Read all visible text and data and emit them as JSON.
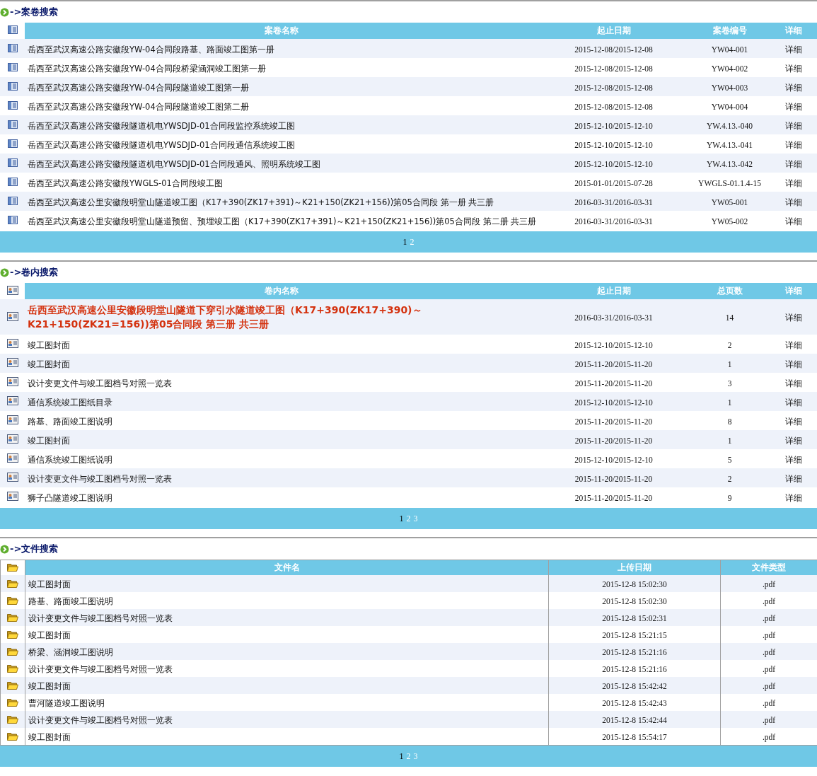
{
  "sections": [
    {
      "kind": "volume",
      "title": "->案卷搜索",
      "columns": [
        "案卷名称",
        "起止日期",
        "案卷编号",
        "详细"
      ],
      "rows": [
        {
          "selected": false,
          "cells": [
            "岳西至武汉高速公路安徽段YW-04合同段路基、路面竣工图第一册",
            "2015-12-08/2015-12-08",
            "YW04-001",
            "详细"
          ]
        },
        {
          "selected": false,
          "cells": [
            "岳西至武汉高速公路安徽段YW-04合同段桥梁涵洞竣工图第一册",
            "2015-12-08/2015-12-08",
            "YW04-002",
            "详细"
          ]
        },
        {
          "selected": false,
          "cells": [
            "岳西至武汉高速公路安徽段YW-04合同段隧道竣工图第一册",
            "2015-12-08/2015-12-08",
            "YW04-003",
            "详细"
          ]
        },
        {
          "selected": false,
          "cells": [
            "岳西至武汉高速公路安徽段YW-04合同段隧道竣工图第二册",
            "2015-12-08/2015-12-08",
            "YW04-004",
            "详细"
          ]
        },
        {
          "selected": false,
          "cells": [
            "岳西至武汉高速公路安徽段隧道机电YWSDJD-01合同段监控系统竣工图",
            "2015-12-10/2015-12-10",
            "YW.4.13.-040",
            "详细"
          ]
        },
        {
          "selected": false,
          "cells": [
            "岳西至武汉高速公路安徽段隧道机电YWSDJD-01合同段通信系统竣工图",
            "2015-12-10/2015-12-10",
            "YW.4.13.-041",
            "详细"
          ]
        },
        {
          "selected": false,
          "cells": [
            "岳西至武汉高速公路安徽段隧道机电YWSDJD-01合同段通风、照明系统竣工图",
            "2015-12-10/2015-12-10",
            "YW.4.13.-042",
            "详细"
          ]
        },
        {
          "selected": false,
          "cells": [
            "岳西至武汉高速公路安徽段YWGLS-01合同段竣工图",
            "2015-01-01/2015-07-28",
            "YWGLS-01.1.4-15",
            "详细"
          ]
        },
        {
          "selected": false,
          "cells": [
            "岳西至武汉高速公里安徽段明堂山隧道竣工图（K17+390(ZK17+391)～K21+150(ZK21+156))第05合同段  第一册  共三册",
            "2016-03-31/2016-03-31",
            "YW05-001",
            "详细"
          ]
        },
        {
          "selected": false,
          "cells": [
            "岳西至武汉高速公里安徽段明堂山隧道预留、预埋竣工图（K17+390(ZK17+391)～K21+150(ZK21+156))第05合同段  第二册  共三册",
            "2016-03-31/2016-03-31",
            "YW05-002",
            "详细"
          ]
        }
      ],
      "pages": [
        {
          "label": "1",
          "selected": true
        },
        {
          "label": "2",
          "selected": false
        }
      ]
    },
    {
      "kind": "item",
      "title": "->卷内搜索",
      "columns": [
        "卷内名称",
        "起止日期",
        "总页数",
        "详细"
      ],
      "rows": [
        {
          "selected": true,
          "cells": [
            "岳西至武汉高速公里安徽段明堂山隧道下穿引水隧道竣工图（K17+390(ZK17+390)～K21+150(ZK21=156))第05合同段  第三册  共三册",
            "2016-03-31/2016-03-31",
            "14",
            "详细"
          ]
        },
        {
          "selected": false,
          "cells": [
            "竣工图封面",
            "2015-12-10/2015-12-10",
            "2",
            "详细"
          ]
        },
        {
          "selected": false,
          "cells": [
            "竣工图封面",
            "2015-11-20/2015-11-20",
            "1",
            "详细"
          ]
        },
        {
          "selected": false,
          "cells": [
            "设计变更文件与竣工图档号对照一览表",
            "2015-11-20/2015-11-20",
            "3",
            "详细"
          ]
        },
        {
          "selected": false,
          "cells": [
            "通信系统竣工图纸目录",
            "2015-12-10/2015-12-10",
            "1",
            "详细"
          ]
        },
        {
          "selected": false,
          "cells": [
            "路基、路面竣工图说明",
            "2015-11-20/2015-11-20",
            "8",
            "详细"
          ]
        },
        {
          "selected": false,
          "cells": [
            "竣工图封面",
            "2015-11-20/2015-11-20",
            "1",
            "详细"
          ]
        },
        {
          "selected": false,
          "cells": [
            "通信系统竣工图纸说明",
            "2015-12-10/2015-12-10",
            "5",
            "详细"
          ]
        },
        {
          "selected": false,
          "cells": [
            "设计变更文件与竣工图档号对照一览表",
            "2015-11-20/2015-11-20",
            "2",
            "详细"
          ]
        },
        {
          "selected": false,
          "cells": [
            "狮子凸隧道竣工图说明",
            "2015-11-20/2015-11-20",
            "9",
            "详细"
          ]
        }
      ],
      "pages": [
        {
          "label": "1",
          "selected": true
        },
        {
          "label": "2",
          "selected": false
        },
        {
          "label": "3",
          "selected": false
        }
      ]
    },
    {
      "kind": "file",
      "title": "->文件搜索",
      "columns": [
        "文件名",
        "上传日期",
        "文件类型"
      ],
      "rows": [
        {
          "selected": false,
          "cells": [
            "竣工图封面",
            "2015-12-8 15:02:30",
            ".pdf"
          ]
        },
        {
          "selected": false,
          "cells": [
            "路基、路面竣工图说明",
            "2015-12-8 15:02:30",
            ".pdf"
          ]
        },
        {
          "selected": false,
          "cells": [
            "设计变更文件与竣工图档号对照一览表",
            "2015-12-8 15:02:31",
            ".pdf"
          ]
        },
        {
          "selected": false,
          "cells": [
            "竣工图封面",
            "2015-12-8 15:21:15",
            ".pdf"
          ]
        },
        {
          "selected": false,
          "cells": [
            "桥梁、涵洞竣工图说明",
            "2015-12-8 15:21:16",
            ".pdf"
          ]
        },
        {
          "selected": false,
          "cells": [
            "设计变更文件与竣工图档号对照一览表",
            "2015-12-8 15:21:16",
            ".pdf"
          ]
        },
        {
          "selected": false,
          "cells": [
            "竣工图封面",
            "2015-12-8 15:42:42",
            ".pdf"
          ]
        },
        {
          "selected": false,
          "cells": [
            "曹河隧道竣工图说明",
            "2015-12-8 15:42:43",
            ".pdf"
          ]
        },
        {
          "selected": false,
          "cells": [
            "设计变更文件与竣工图档号对照一览表",
            "2015-12-8 15:42:44",
            ".pdf"
          ]
        },
        {
          "selected": false,
          "cells": [
            "竣工图封面",
            "2015-12-8 15:54:17",
            ".pdf"
          ]
        }
      ],
      "pages": [
        {
          "label": "1",
          "selected": true
        },
        {
          "label": "2",
          "selected": false
        },
        {
          "label": "3",
          "selected": false
        }
      ]
    }
  ]
}
